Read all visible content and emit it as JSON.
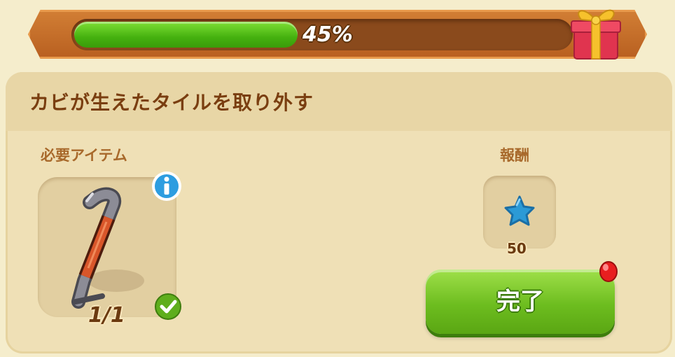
{
  "progress": {
    "percent_label": "45%",
    "value": 0.45,
    "fill_color": "#4cba12"
  },
  "quest": {
    "title": "カビが生えたタイルを取り外す",
    "required_label": "必要アイテム",
    "reward_label": "報酬",
    "item": {
      "icon": "crowbar-icon",
      "count": "1/1",
      "status": "complete"
    },
    "reward": {
      "icon": "blue-star-icon",
      "amount": "50"
    },
    "complete_button": "完了"
  },
  "colors": {
    "frame": "#c36c28",
    "panel": "#efe0b6",
    "title": "#7a3e10",
    "button": "#6dbd1f"
  }
}
